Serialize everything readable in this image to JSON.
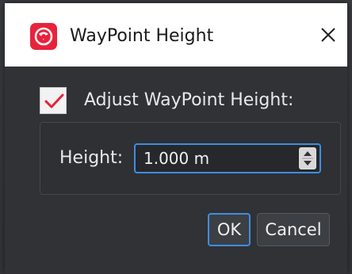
{
  "window": {
    "title": "WayPoint Height",
    "app_icon": "app-logo-icon",
    "close_icon": "close-icon",
    "accent_color": "#e8223c"
  },
  "options": {
    "adjust_checkbox_label": "Adjust WayPoint Height:",
    "adjust_checked": true,
    "check_color": "#e8223c"
  },
  "height": {
    "label": "Height:",
    "value": "1.000 m"
  },
  "buttons": {
    "ok_label": "OK",
    "cancel_label": "Cancel"
  }
}
